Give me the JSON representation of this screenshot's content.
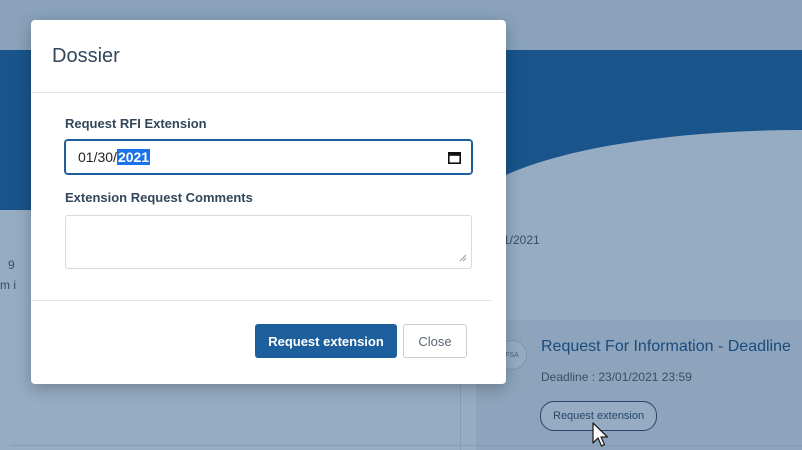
{
  "background": {
    "partial_date": "1/2021",
    "edge_text_1": "9",
    "edge_text_2": "m i",
    "fsa_badge": "FSA",
    "item_title": "Request For Information - Deadline",
    "item_deadline": "Deadline : 23/01/2021 23:59",
    "item_button": "Request extension"
  },
  "modal": {
    "title": "Dossier",
    "rfi_label": "Request RFI Extension",
    "date_value_prefix": "01/30/",
    "date_value_selected": "2021",
    "comments_label": "Extension Request Comments",
    "comments_value": "",
    "request_button": "Request extension",
    "close_button": "Close"
  },
  "colors": {
    "primary": "#1d5f9c",
    "overlay": "rgba(22,70,120,0.45)",
    "selection": "#1a73e8"
  },
  "icons": {
    "calendar": "calendar-icon",
    "resize": "resize-handle-icon",
    "cursor": "mouse-pointer-icon"
  }
}
